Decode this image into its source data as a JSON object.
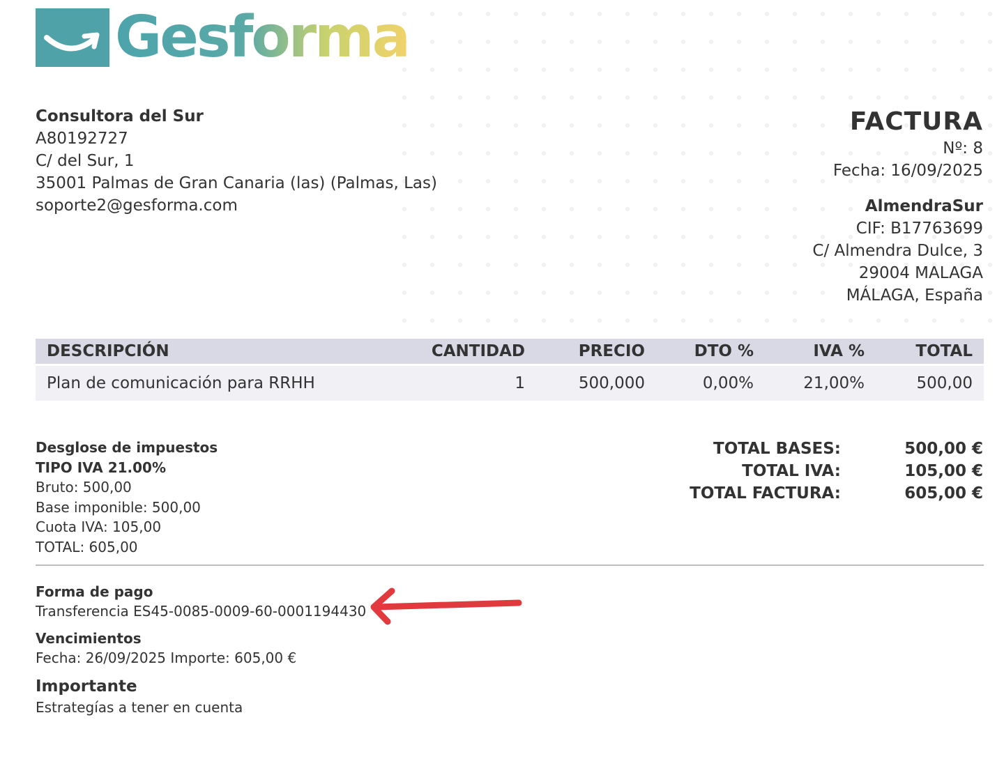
{
  "brand": {
    "name": "Gesforma"
  },
  "seller": {
    "name": "Consultora del Sur",
    "tax_id": "A80192727",
    "address": "C/ del Sur, 1",
    "city": "35001 Palmas de Gran Canaria (las) (Palmas, Las)",
    "email": "soporte2@gesforma.com"
  },
  "invoice": {
    "title": "FACTURA",
    "number": "Nº: 8",
    "date": "Fecha: 16/09/2025"
  },
  "buyer": {
    "name": "AlmendraSur",
    "cif": "CIF: B17763699",
    "address": "C/ Almendra Dulce, 3",
    "city": "29004 MALAGA",
    "region": "MÁLAGA, España"
  },
  "table": {
    "headers": [
      "DESCRIPCIÓN",
      "CANTIDAD",
      "PRECIO",
      "DTO %",
      "IVA %",
      "TOTAL"
    ],
    "rows": [
      [
        "Plan de comunicación para RRHH",
        "1",
        "500,000",
        "0,00%",
        "21,00%",
        "500,00"
      ]
    ]
  },
  "tax_breakdown": {
    "title": "Desglose de impuestos",
    "type": "TIPO IVA 21.00%",
    "bruto": "Bruto: 500,00",
    "base": "Base imponible: 500,00",
    "cuota": "Cuota IVA: 105,00",
    "total": "TOTAL: 605,00"
  },
  "totals": [
    {
      "label": "TOTAL BASES:",
      "value": "500,00 €"
    },
    {
      "label": "TOTAL IVA:",
      "value": "105,00 €"
    },
    {
      "label": "TOTAL FACTURA:",
      "value": "605,00 €"
    }
  ],
  "payment": {
    "title": "Forma de pago",
    "text": "Transferencia ES45-0085-0009-60-0001194430"
  },
  "due": {
    "title": "Vencimientos",
    "text": "Fecha: 26/09/2025 Importe: 605,00 €"
  },
  "important": {
    "title": "Importante",
    "text": "Estrategías a tener en cuenta"
  },
  "colors": {
    "accent": "#4fa3a8",
    "arrow": "#e0393e",
    "header_bg": "#d9d9e6",
    "row_bg": "#f0f0f5"
  }
}
